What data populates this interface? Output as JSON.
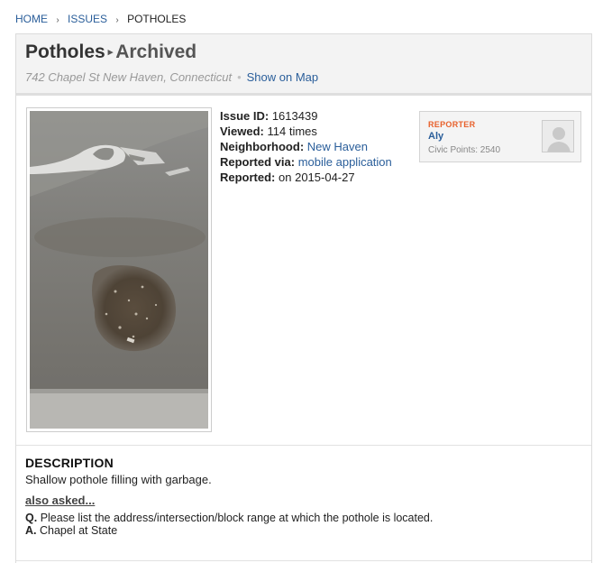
{
  "breadcrumb": {
    "home": "HOME",
    "issues": "ISSUES",
    "current": "POTHOLES",
    "separator": "›"
  },
  "issue": {
    "title": "Potholes",
    "status": "Archived",
    "address": "742 Chapel St New Haven, Connecticut",
    "map_link": "Show on Map"
  },
  "details": {
    "issue_id_label": "Issue ID:",
    "issue_id": "1613439",
    "viewed_label": "Viewed:",
    "viewed": "114 times",
    "neighborhood_label": "Neighborhood:",
    "neighborhood": "New Haven",
    "reported_via_label": "Reported via:",
    "reported_via": "mobile application",
    "reported_label": "Reported:",
    "reported": "on 2015-04-27"
  },
  "reporter": {
    "label": "REPORTER",
    "name": "Aly",
    "civic_points": "Civic Points: 2540"
  },
  "description": {
    "heading": "DESCRIPTION",
    "text": "Shallow pothole filling with garbage.",
    "also_asked": "also asked...",
    "q_label": "Q.",
    "question": "Please list the address/intersection/block range at which the pothole is located.",
    "a_label": "A.",
    "answer": "Chapel at State"
  },
  "colors": {
    "link": "#2a5e9a",
    "reporter_label": "#e8612c",
    "header_bg": "#f3f3f3"
  },
  "icons": {
    "avatar": "default-user-silhouette",
    "photo": "pothole-photo"
  }
}
